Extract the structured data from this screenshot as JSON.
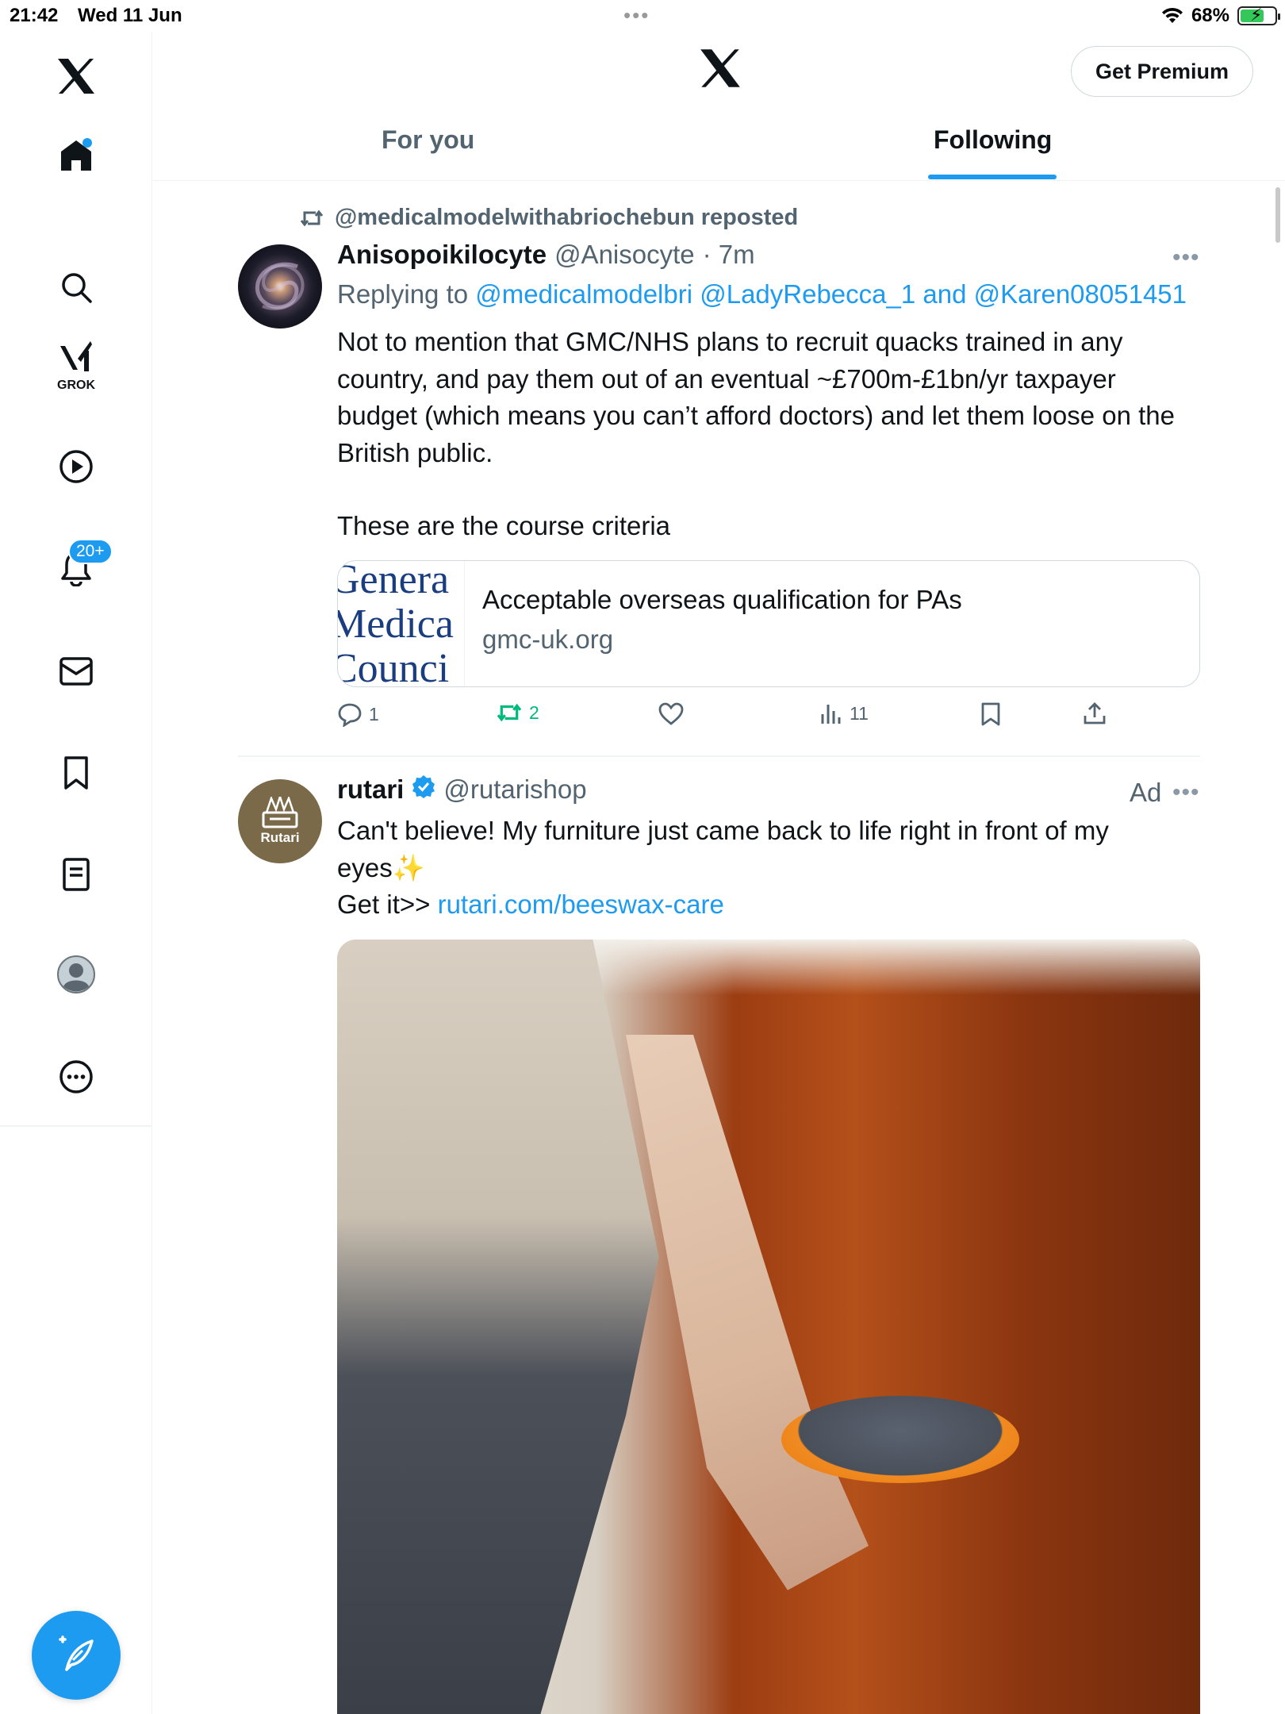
{
  "status_bar": {
    "time": "21:42",
    "date": "Wed 11 Jun",
    "battery": "68%",
    "battery_level": 0.68
  },
  "header": {
    "premium_button": "Get Premium",
    "tabs": [
      {
        "label": "For you",
        "active": false
      },
      {
        "label": "Following",
        "active": true
      }
    ]
  },
  "sidebar": {
    "items": [
      {
        "icon": "x-logo-icon"
      },
      {
        "icon": "home-icon",
        "has_dot": true
      },
      {
        "icon": "search-icon"
      },
      {
        "icon": "grok-icon",
        "label": "GROK"
      },
      {
        "icon": "video-icon"
      },
      {
        "icon": "notifications-icon",
        "badge": "20+"
      },
      {
        "icon": "messages-icon"
      },
      {
        "icon": "bookmarks-icon"
      },
      {
        "icon": "lists-icon"
      },
      {
        "icon": "profile-icon"
      },
      {
        "icon": "more-icon"
      }
    ],
    "compose_icon": "compose-icon"
  },
  "tweets": [
    {
      "repost_text": "@medicalmodelwithabriochebun reposted",
      "name": "Anisopoikilocyte",
      "handle": "@Anisocyte",
      "time": "· 7m",
      "replying_to_label": "Replying to",
      "replying_to_users": "@medicalmodelbri @LadyRebecca_1 and @Karen08051451",
      "text_1": "Not to mention that GMC/NHS plans to recruit quacks trained in any country, and pay them out of an eventual ~£700m-£1bn/yr taxpayer budget (which means you can’t afford doctors) and let them loose on the British public.",
      "text_2": "These are the course criteria",
      "card": {
        "thumb_lines": [
          "Genera",
          "Medica",
          "Counci"
        ],
        "title": "Acceptable overseas qualification for PAs",
        "domain": "gmc-uk.org"
      },
      "actions": {
        "replies": "1",
        "reposts": "2",
        "likes": "",
        "views": "11"
      }
    },
    {
      "name": "rutari",
      "verified": true,
      "handle": "@rutarishop",
      "ad_label": "Ad",
      "avatar_label": "Rutari",
      "text_1": "Can't believe! My furniture just came back to life right in front of my eyes",
      "sparkle": "✨",
      "text_2_prefix": "Get it>> ",
      "text_2_link": "rutari.com/beeswax-care"
    }
  ],
  "colors": {
    "accent": "#1d9bf0",
    "secondary_text": "#536471",
    "repost_green": "#00ba7c",
    "border": "#eff3f4"
  }
}
